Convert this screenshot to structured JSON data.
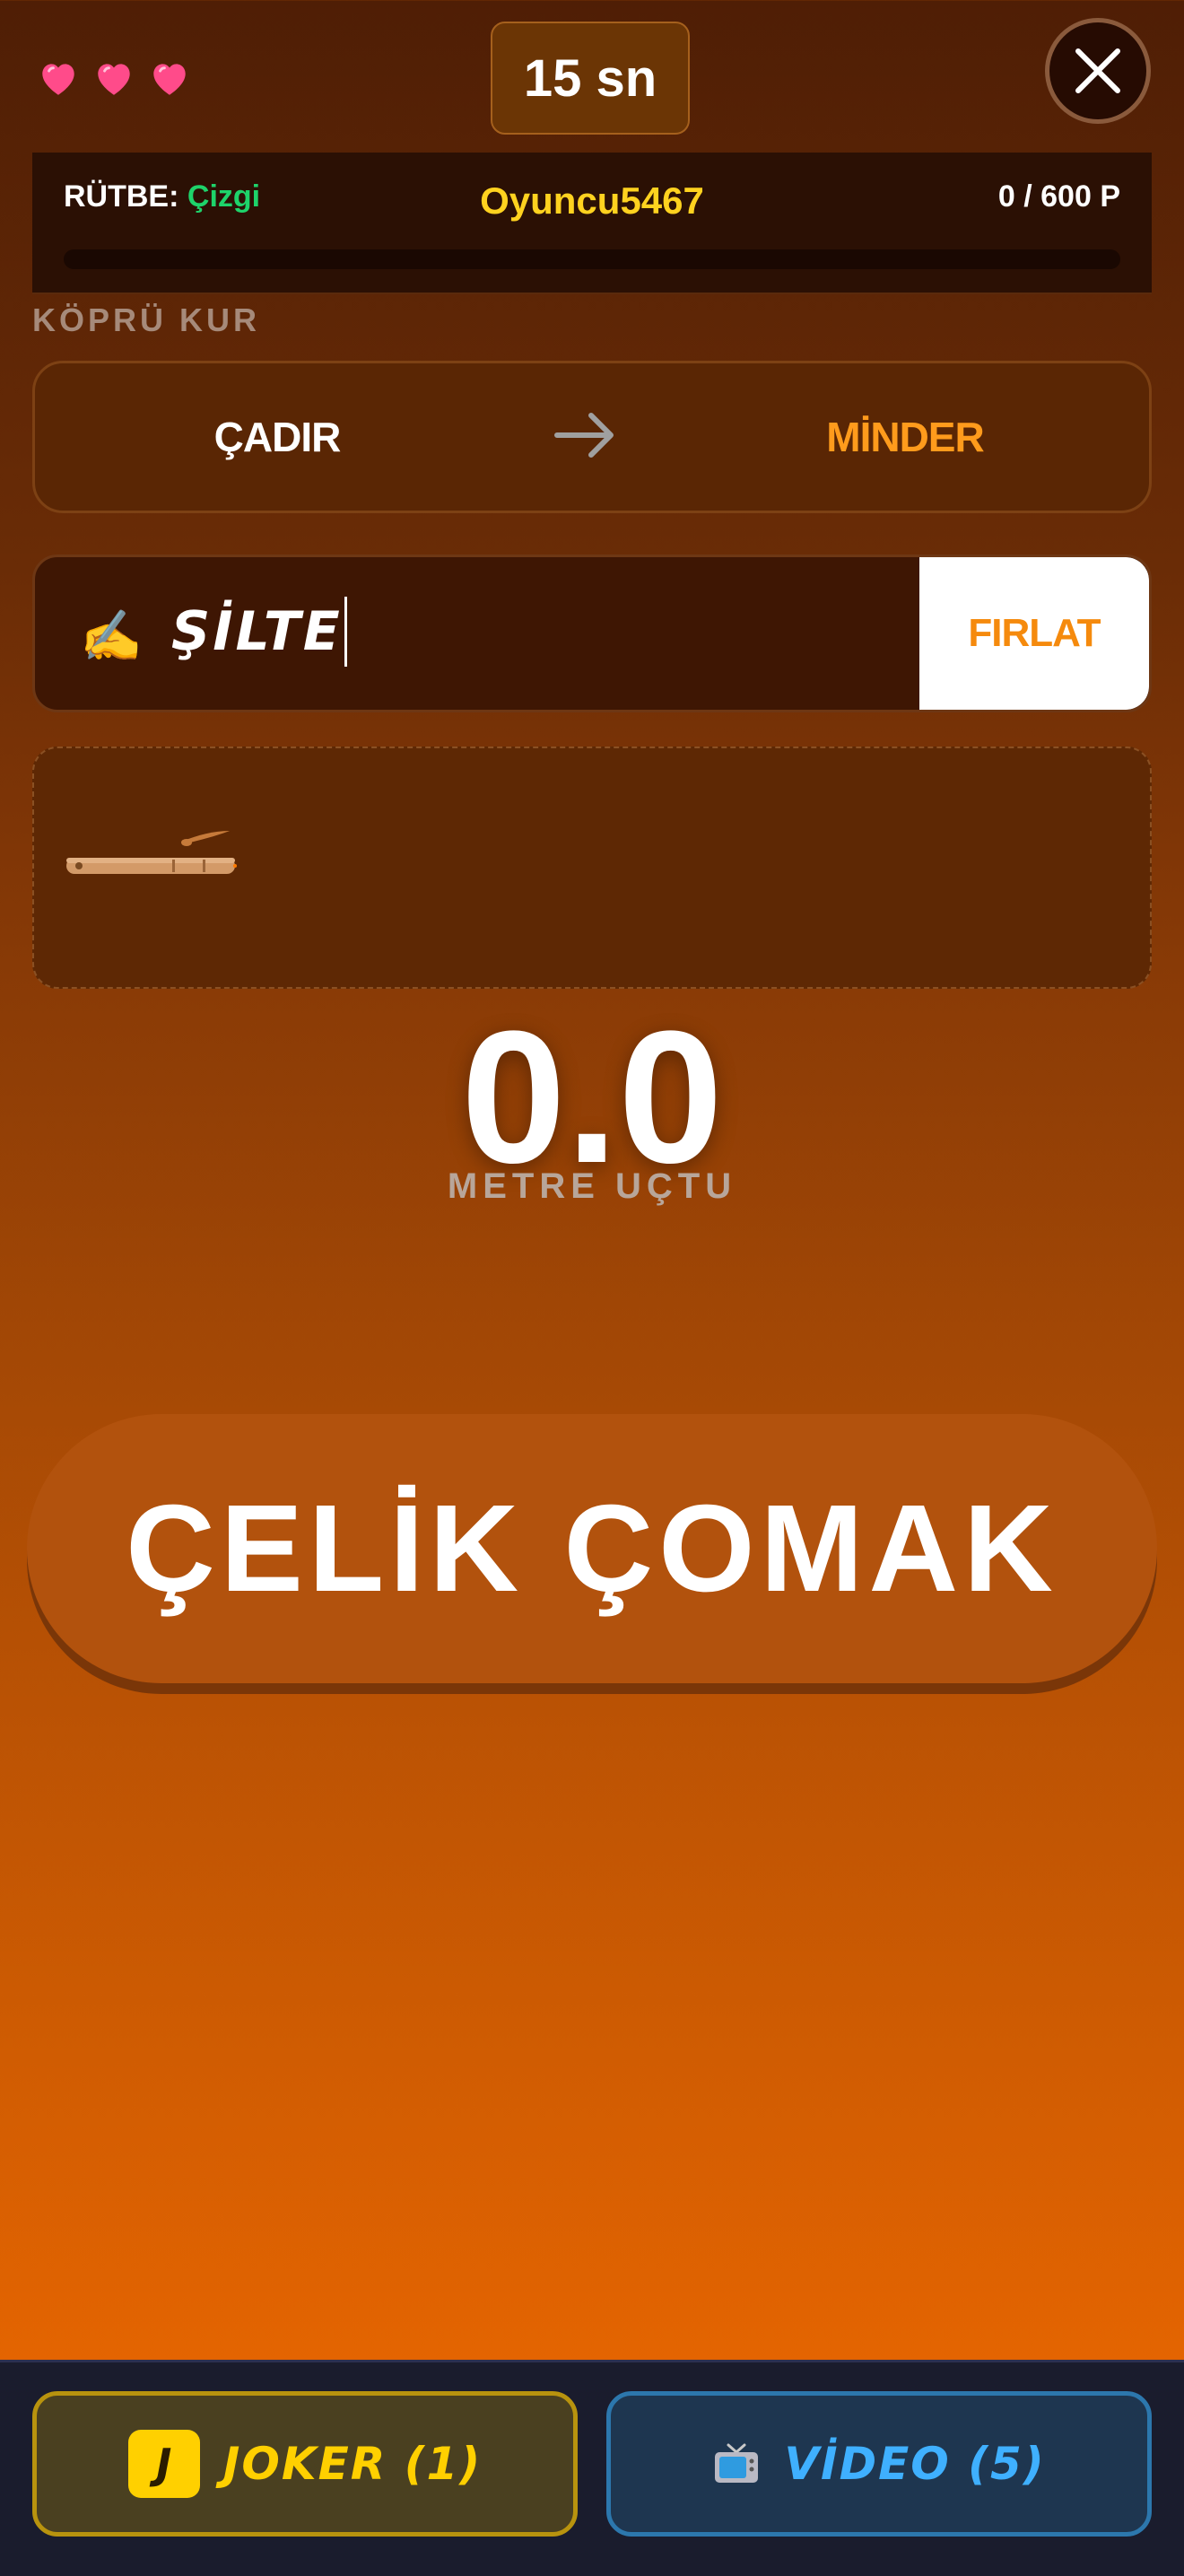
{
  "hud": {
    "lives": 3,
    "timer": "15 sn"
  },
  "rank": {
    "label": "RÜTBE: ",
    "value": "Çizgi",
    "player": "Oyuncu5467",
    "points": "0 / 600 P",
    "progress": 0
  },
  "bridge": {
    "title": "KÖPRÜ KUR",
    "from_word": "ÇADIR",
    "to_word": "MİNDER"
  },
  "input": {
    "icon": "✍️",
    "value": "ŞİLTE",
    "submit_label": "FIRLAT"
  },
  "distance": {
    "value": "0.0",
    "label": "METRE UÇTU"
  },
  "main_button": {
    "label": "ÇELİK ÇOMAK"
  },
  "bottom": {
    "joker_badge": "J",
    "joker_label": "JOKER (1)",
    "video_icon": "📺",
    "video_label": "VİDEO (5)"
  },
  "colors": {
    "accent_orange": "#ff9b1c",
    "rank_green": "#1ed36a",
    "name_yellow": "#ffd21f",
    "joker_yellow": "#ffd000",
    "video_blue": "#3fb0ff"
  }
}
